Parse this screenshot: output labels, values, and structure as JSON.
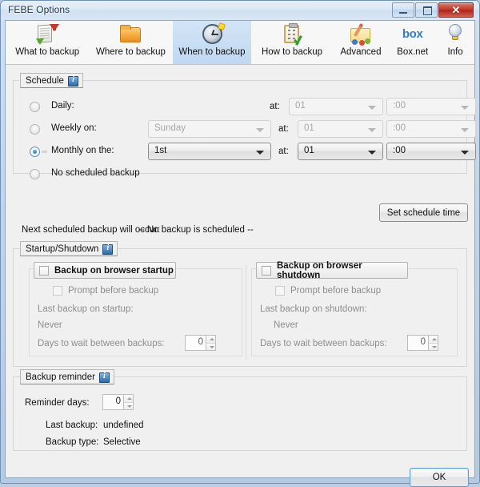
{
  "window": {
    "title": "FEBE Options",
    "controls": {
      "minimize": "minimize",
      "maximize": "maximize",
      "close": "✕"
    }
  },
  "tabs": [
    {
      "label": "What to backup",
      "icon": "document-export-icon",
      "selected": false
    },
    {
      "label": "Where to backup",
      "icon": "folder-icon",
      "selected": false
    },
    {
      "label": "When to backup",
      "icon": "clock-icon",
      "selected": true
    },
    {
      "label": "How to backup",
      "icon": "clipboard-check-icon",
      "selected": false
    },
    {
      "label": "Advanced",
      "icon": "toolbox-icon",
      "selected": false
    },
    {
      "label": "Box.net",
      "icon": "box-logo-icon",
      "selected": false
    },
    {
      "label": "Info",
      "icon": "lightbulb-icon",
      "selected": false
    }
  ],
  "schedule": {
    "legend": "Schedule",
    "info_icon": "info-icon",
    "options": [
      {
        "label": "Daily:",
        "selected": false,
        "enabled": true
      },
      {
        "label": "Weekly on:",
        "selected": false,
        "enabled": true
      },
      {
        "label": "Monthly on the:",
        "selected": true,
        "enabled": true
      },
      {
        "label": "No scheduled backup",
        "selected": false,
        "enabled": true
      }
    ],
    "at_label": "at:",
    "rows": [
      {
        "day_value": "",
        "hour_value": "01",
        "minute_value": ":00",
        "enabled": false
      },
      {
        "day_value": "Sunday",
        "hour_value": "01",
        "minute_value": ":00",
        "enabled": false
      },
      {
        "day_value": "1st",
        "hour_value": "01",
        "minute_value": ":00",
        "enabled": true
      }
    ],
    "set_time_button": "Set schedule time",
    "next_backup_label": "Next scheduled backup will occur:",
    "next_backup_value": "--  No backup is scheduled  --"
  },
  "startup_shutdown": {
    "legend": "Startup/Shutdown",
    "info_icon": "info-icon",
    "startup": {
      "toggle_label": "Backup on browser startup",
      "toggle_checked": false,
      "prompt_label": "Prompt before backup",
      "prompt_checked": false,
      "last_backup_label": "Last backup on startup:",
      "last_backup_value": "Never",
      "days_label": "Days to wait between backups:",
      "days_value": "0"
    },
    "shutdown": {
      "toggle_label": "Backup on browser shutdown",
      "toggle_checked": false,
      "prompt_label": "Prompt before backup",
      "prompt_checked": false,
      "last_backup_label": "Last backup on shutdown:",
      "last_backup_value": "Never",
      "days_label": "Days to wait between backups:",
      "days_value": "0"
    }
  },
  "backup_reminder": {
    "legend": "Backup reminder",
    "info_icon": "info-icon",
    "reminder_days_label": "Reminder days:",
    "reminder_days_value": "0",
    "last_backup_label": "Last backup:",
    "last_backup_value": "undefined",
    "backup_type_label": "Backup type:",
    "backup_type_value": "Selective"
  },
  "footer": {
    "ok_button": "OK"
  }
}
